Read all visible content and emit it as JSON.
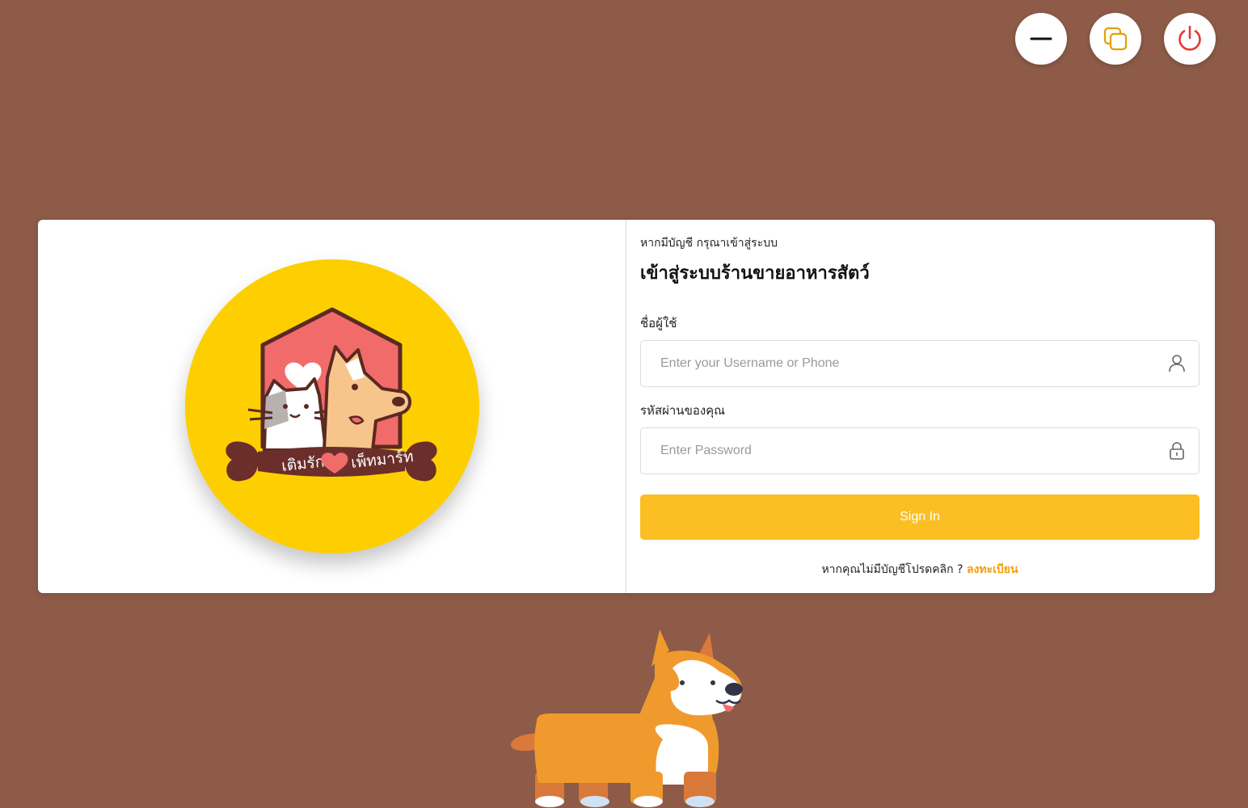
{
  "window_controls": {
    "minimize_icon": "minus-icon",
    "restore_icon": "restore-windows-icon",
    "power_icon": "power-icon",
    "power_color": "#e53935",
    "restore_color": "#e0a100"
  },
  "brand": {
    "logo_text": "เติมรัก ❤ เพ็ทมาร์ท",
    "logo_bg": "#fdcf00"
  },
  "login": {
    "subtitle": "หากมีบัญชี กรุณาเข้าสู่ระบบ",
    "title": "เข้าสู่ระบบร้านขายอาหารสัตว์",
    "username_label": "ชื่อผู้ใช้",
    "username_placeholder": "Enter your Username or Phone",
    "username_value": "",
    "username_icon": "user-icon",
    "password_label": "รหัสผ่านของคุณ",
    "password_placeholder": "Enter Password",
    "password_value": "",
    "password_icon": "lock-icon",
    "signin_label": "Sign In",
    "signin_color": "#fbbf24",
    "register_prompt": "หากคุณไม่มีบัญชีโปรดคลิก ?",
    "register_link": "ลงทะเบียน",
    "register_color": "#f59e0b"
  },
  "background_color": "#8d5b48"
}
